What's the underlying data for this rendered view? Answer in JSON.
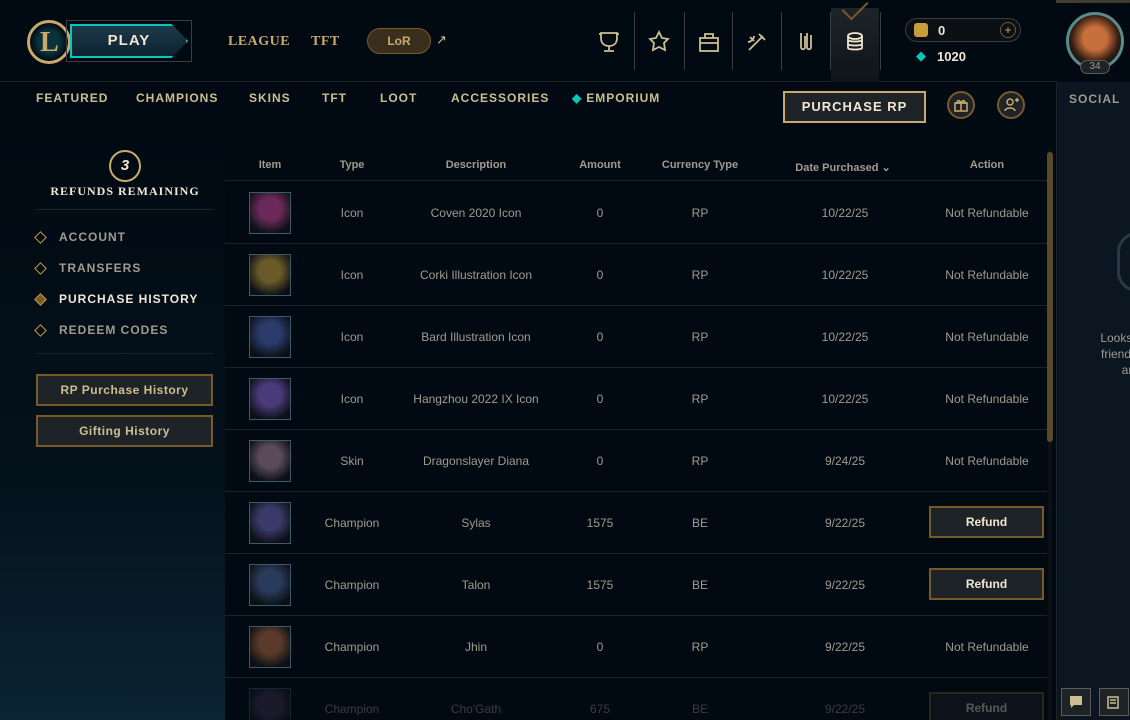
{
  "colors": {
    "gold": "#c8aa6e",
    "teal": "#0ac8b9",
    "bg": "#010a13",
    "text": "#a09b8c"
  },
  "header": {
    "logo_letter": "L",
    "play_label": "PLAY",
    "nav": [
      {
        "label": "LEAGUE"
      },
      {
        "label": "TFT"
      }
    ],
    "lor_label": "LoR",
    "ext_arrow": "↗",
    "icons": [
      "trophy-icon",
      "ranked-icon",
      "collection-icon",
      "loot-icon",
      "clash-icon",
      "store-icon"
    ],
    "rp_value": "0",
    "be_value": "1020",
    "level": "34"
  },
  "subnav": {
    "items": [
      {
        "label": "FEATURED"
      },
      {
        "label": "CHAMPIONS"
      },
      {
        "label": "SKINS"
      },
      {
        "label": "TFT"
      },
      {
        "label": "LOOT"
      },
      {
        "label": "ACCESSORIES"
      },
      {
        "label": "EMPORIUM"
      }
    ],
    "purchase_rp": "PURCHASE RP"
  },
  "social": {
    "title": "SOCIAL",
    "empty_lines": [
      "Looks like",
      "friends ye",
      "ar"
    ]
  },
  "sidebar": {
    "refunds_count": "3",
    "refunds_label": "REFUNDS REMAINING",
    "items": [
      {
        "label": "ACCOUNT"
      },
      {
        "label": "TRANSFERS"
      },
      {
        "label": "PURCHASE HISTORY"
      },
      {
        "label": "REDEEM CODES"
      }
    ],
    "rp_history_btn": "RP Purchase History",
    "gifting_history_btn": "Gifting History"
  },
  "table": {
    "headers": {
      "item": "Item",
      "type": "Type",
      "description": "Description",
      "amount": "Amount",
      "currency": "Currency Type",
      "date": "Date Purchased",
      "action": "Action"
    },
    "rows": [
      {
        "type": "Icon",
        "description": "Coven 2020 Icon",
        "amount": "0",
        "currency": "RP",
        "date": "10/22/25",
        "action": "Not Refundable",
        "refundable": false,
        "thumb_color": "#6a2a5a"
      },
      {
        "type": "Icon",
        "description": "Corki Illustration Icon",
        "amount": "0",
        "currency": "RP",
        "date": "10/22/25",
        "action": "Not Refundable",
        "refundable": false,
        "thumb_color": "#6a5a2a"
      },
      {
        "type": "Icon",
        "description": "Bard Illustration Icon",
        "amount": "0",
        "currency": "RP",
        "date": "10/22/25",
        "action": "Not Refundable",
        "refundable": false,
        "thumb_color": "#2a3a6a"
      },
      {
        "type": "Icon",
        "description": "Hangzhou 2022 IX Icon",
        "amount": "0",
        "currency": "RP",
        "date": "10/22/25",
        "action": "Not Refundable",
        "refundable": false,
        "thumb_color": "#4a3a7a"
      },
      {
        "type": "Skin",
        "description": "Dragonslayer Diana",
        "amount": "0",
        "currency": "RP",
        "date": "9/24/25",
        "action": "Not Refundable",
        "refundable": false,
        "thumb_color": "#5a4a5a"
      },
      {
        "type": "Champion",
        "description": "Sylas",
        "amount": "1575",
        "currency": "BE",
        "date": "9/22/25",
        "action": "Refund",
        "refundable": true,
        "thumb_color": "#3a3a6a"
      },
      {
        "type": "Champion",
        "description": "Talon",
        "amount": "1575",
        "currency": "BE",
        "date": "9/22/25",
        "action": "Refund",
        "refundable": true,
        "thumb_color": "#2a3a5a"
      },
      {
        "type": "Champion",
        "description": "Jhin",
        "amount": "0",
        "currency": "RP",
        "date": "9/22/25",
        "action": "Not Refundable",
        "refundable": false,
        "thumb_color": "#5a3a2a"
      },
      {
        "type": "Champion",
        "description": "Cho'Gath",
        "amount": "675",
        "currency": "BE",
        "date": "9/22/25",
        "action": "Refund",
        "refundable": true,
        "thumb_color": "#4a3a5a"
      }
    ]
  }
}
